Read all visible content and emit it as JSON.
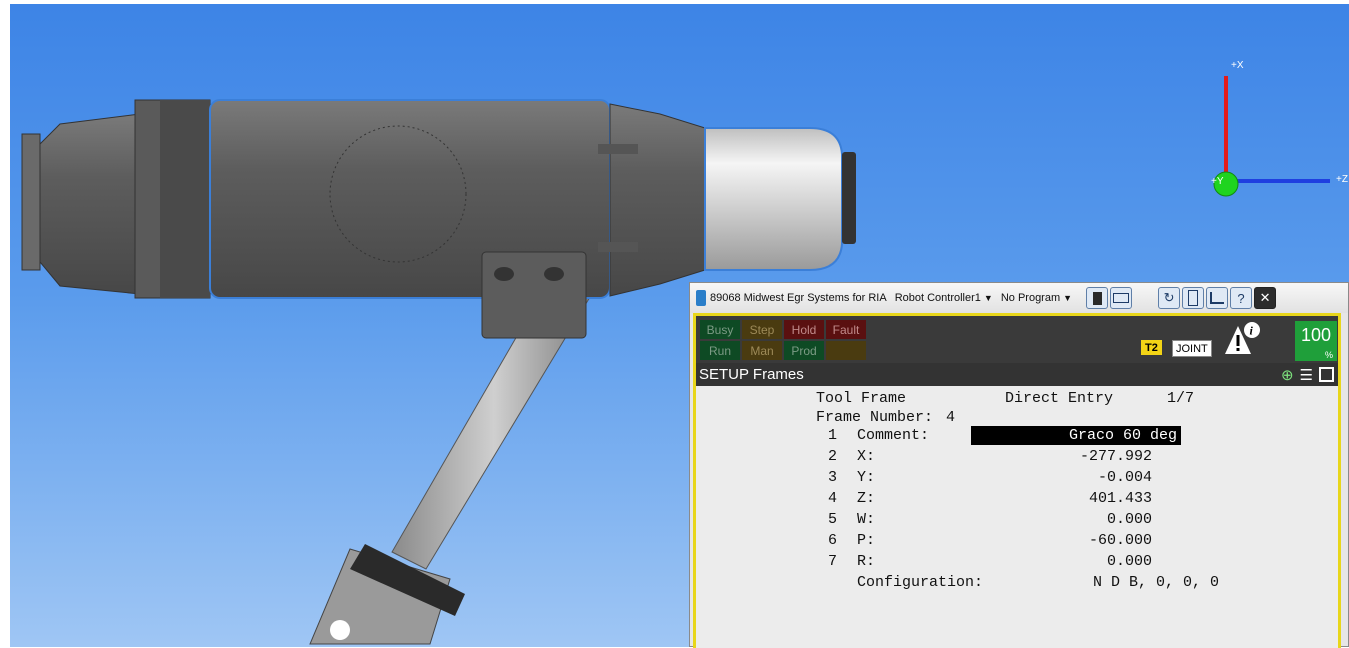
{
  "titlebar": {
    "controller_title": "89068 Midwest Egr Systems for RIA",
    "robot_selector": "Robot Controller1",
    "program_selector": "No Program",
    "icons": [
      "teach-pendant-icon",
      "keyboard-icon",
      "refresh-icon",
      "tool-icon",
      "move-icon",
      "help-icon",
      "close-icon"
    ],
    "refresh_glyph": "↻",
    "help_glyph": "?",
    "close_glyph": "✕"
  },
  "status": {
    "leds": [
      "Busy",
      "Step",
      "Hold",
      "Fault",
      "Run",
      "Man",
      "Prod"
    ],
    "mode_badge": "T2",
    "coord_badge": "JOINT",
    "override_value": "100",
    "override_unit": "%"
  },
  "screen": {
    "title": "SETUP Frames",
    "header_line": "Tool Frame",
    "method": "Direct Entry",
    "page": "1/7",
    "frame_number_label": "Frame Number:",
    "frame_number": "4",
    "rows": [
      {
        "num": "1",
        "label": "Comment:",
        "value": "Graco 60 deg"
      },
      {
        "num": "2",
        "label": "X:",
        "value": "-277.992"
      },
      {
        "num": "3",
        "label": "Y:",
        "value": "-0.004"
      },
      {
        "num": "4",
        "label": "Z:",
        "value": "401.433"
      },
      {
        "num": "5",
        "label": "W:",
        "value": "0.000"
      },
      {
        "num": "6",
        "label": "P:",
        "value": "-60.000"
      },
      {
        "num": "7",
        "label": "R:",
        "value": "0.000"
      }
    ],
    "config_label": "Configuration:",
    "config_value": "N D B, 0, 0, 0"
  },
  "axes": {
    "x_label": "+X",
    "y_label": "+Y",
    "z_label": "+Z"
  },
  "colors": {
    "sky_top": "#3d84e6",
    "sky_bottom": "#9fc6f4",
    "highlight": "#e8d61a",
    "override_green": "#1f9f3a"
  }
}
